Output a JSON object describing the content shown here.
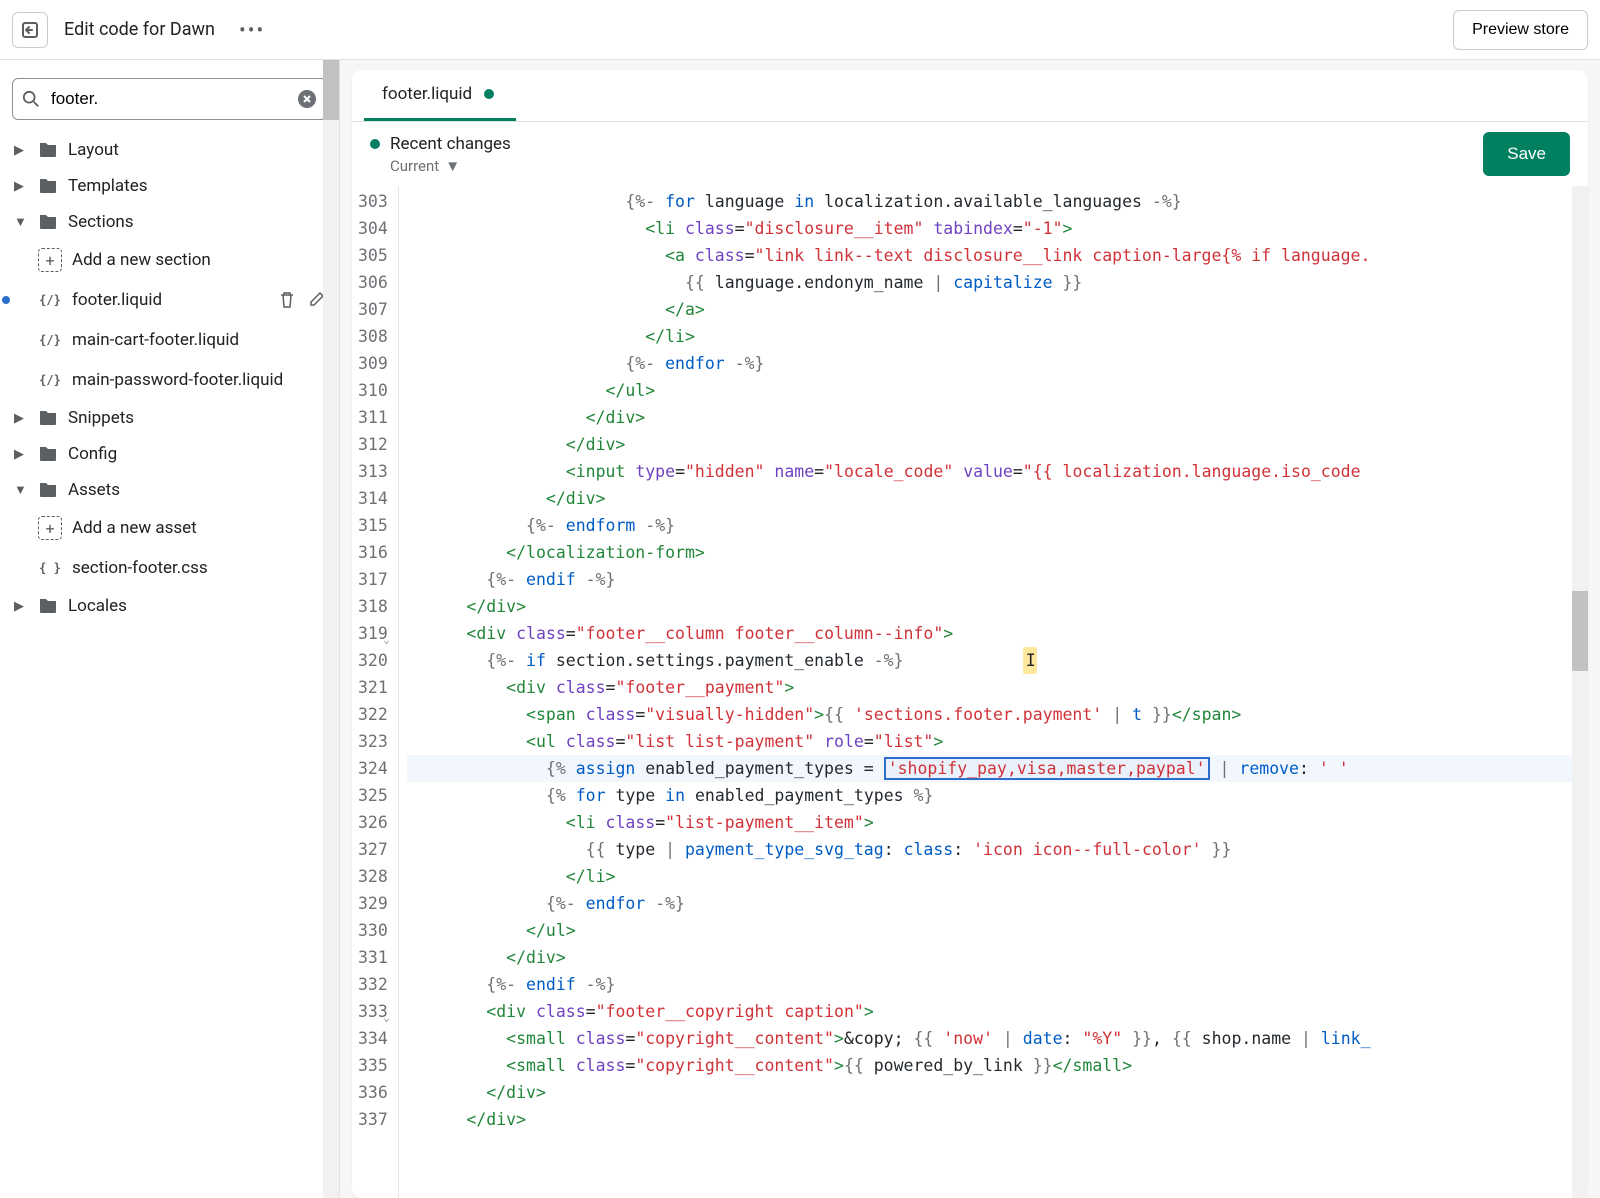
{
  "topbar": {
    "title": "Edit code for Dawn",
    "preview_label": "Preview store"
  },
  "sidebar": {
    "search_value": "footer.",
    "folders": {
      "layout": "Layout",
      "templates": "Templates",
      "sections": "Sections",
      "snippets": "Snippets",
      "config": "Config",
      "assets": "Assets",
      "locales": "Locales"
    },
    "add_section": "Add a new section",
    "add_asset": "Add a new asset",
    "files": {
      "footer": "footer.liquid",
      "main_cart": "main-cart-footer.liquid",
      "main_password": "main-password-footer.liquid",
      "section_footer_css": "section-footer.css"
    }
  },
  "editor": {
    "tab_name": "footer.liquid",
    "recent_changes": "Recent changes",
    "current": "Current",
    "save": "Save"
  },
  "code": {
    "lines": [
      {
        "n": 303,
        "html": "                      <span class='c-liq'>{%-</span> <span class='c-kw'>for</span> <span class='c-var'>language</span> <span class='c-kw'>in</span> <span class='c-var'>localization.available_languages</span> <span class='c-liq'>-%}</span>"
      },
      {
        "n": 304,
        "html": "                        <span class='c-tag'>&lt;li</span> <span class='c-attr'>class</span>=<span class='c-str'>\"disclosure__item\"</span> <span class='c-attr'>tabindex</span>=<span class='c-str'>\"-1\"</span><span class='c-tag'>&gt;</span>"
      },
      {
        "n": 305,
        "html": "                          <span class='c-tag'>&lt;a</span> <span class='c-attr'>class</span>=<span class='c-str'>\"link link--text disclosure__link caption-large{% if language.</span>"
      },
      {
        "n": 306,
        "html": "                            <span class='c-liq'>{{</span> <span class='c-var'>language.endonym_name</span> <span class='c-liq'>|</span> <span class='c-filter'>capitalize</span> <span class='c-liq'>}}</span>"
      },
      {
        "n": 307,
        "html": "                          <span class='c-tag'>&lt;/a&gt;</span>"
      },
      {
        "n": 308,
        "html": "                        <span class='c-tag'>&lt;/li&gt;</span>"
      },
      {
        "n": 309,
        "html": "                      <span class='c-liq'>{%-</span> <span class='c-kw'>endfor</span> <span class='c-liq'>-%}</span>"
      },
      {
        "n": 310,
        "html": "                    <span class='c-tag'>&lt;/ul&gt;</span>"
      },
      {
        "n": 311,
        "html": "                  <span class='c-tag'>&lt;/div&gt;</span>"
      },
      {
        "n": 312,
        "html": "                <span class='c-tag'>&lt;/div&gt;</span>"
      },
      {
        "n": 313,
        "html": "                <span class='c-tag'>&lt;input</span> <span class='c-attr'>type</span>=<span class='c-str'>\"hidden\"</span> <span class='c-attr'>name</span>=<span class='c-str'>\"locale_code\"</span> <span class='c-attr'>value</span>=<span class='c-str'>\"{{ localization.language.iso_code</span>"
      },
      {
        "n": 314,
        "html": "              <span class='c-tag'>&lt;/div&gt;</span>"
      },
      {
        "n": 315,
        "html": "            <span class='c-liq'>{%-</span> <span class='c-kw'>endform</span> <span class='c-liq'>-%}</span>"
      },
      {
        "n": 316,
        "html": "          <span class='c-tag'>&lt;/localization-form&gt;</span>"
      },
      {
        "n": 317,
        "html": "        <span class='c-liq'>{%-</span> <span class='c-kw'>endif</span> <span class='c-liq'>-%}</span>"
      },
      {
        "n": 318,
        "html": "      <span class='c-tag'>&lt;/div&gt;</span>"
      },
      {
        "n": 319,
        "fold": true,
        "html": "      <span class='c-tag'>&lt;div</span> <span class='c-attr'>class</span>=<span class='c-str'>\"footer__column footer__column--info\"</span><span class='c-tag'>&gt;</span>"
      },
      {
        "n": 320,
        "cursor": true,
        "html": "        <span class='c-liq'>{%-</span> <span class='c-kw'>if</span> <span class='c-var'>section.settings.payment_enable</span> <span class='c-liq'>-%}</span>            <span class='cursor-mark'>I</span>"
      },
      {
        "n": 321,
        "html": "          <span class='c-tag'>&lt;div</span> <span class='c-attr'>class</span>=<span class='c-str'>\"footer__payment\"</span><span class='c-tag'>&gt;</span>"
      },
      {
        "n": 322,
        "html": "            <span class='c-tag'>&lt;span</span> <span class='c-attr'>class</span>=<span class='c-str'>\"visually-hidden\"</span><span class='c-tag'>&gt;</span><span class='c-liq'>{{</span> <span class='c-str'>'sections.footer.payment'</span> <span class='c-liq'>|</span> <span class='c-filter'>t</span> <span class='c-liq'>}}</span><span class='c-tag'>&lt;/span&gt;</span>"
      },
      {
        "n": 323,
        "html": "            <span class='c-tag'>&lt;ul</span> <span class='c-attr'>class</span>=<span class='c-str'>\"list list-payment\"</span> <span class='c-attr'>role</span>=<span class='c-str'>\"list\"</span><span class='c-tag'>&gt;</span>"
      },
      {
        "n": 324,
        "hl": true,
        "html": "              <span class='c-liq'>{%</span> <span class='c-kw'>assign</span> <span class='c-var'>enabled_payment_types</span> = <span class='sel-box'><span class='c-str'>'shopify_pay,visa,master,paypal'</span></span> <span class='c-liq'>|</span> <span class='c-filter'>remove</span>: <span class='c-str'>' '</span>"
      },
      {
        "n": 325,
        "html": "              <span class='c-liq'>{%</span> <span class='c-kw'>for</span> <span class='c-var'>type</span> <span class='c-kw'>in</span> <span class='c-var'>enabled_payment_types</span> <span class='c-liq'>%}</span>"
      },
      {
        "n": 326,
        "html": "                <span class='c-tag'>&lt;li</span> <span class='c-attr'>class</span>=<span class='c-str'>\"list-payment__item\"</span><span class='c-tag'>&gt;</span>"
      },
      {
        "n": 327,
        "html": "                  <span class='c-liq'>{{</span> <span class='c-var'>type</span> <span class='c-liq'>|</span> <span class='c-filter'>payment_type_svg_tag</span>: <span class='c-filter'>class</span>: <span class='c-str'>'icon icon--full-color'</span> <span class='c-liq'>}}</span>"
      },
      {
        "n": 328,
        "html": "                <span class='c-tag'>&lt;/li&gt;</span>"
      },
      {
        "n": 329,
        "html": "              <span class='c-liq'>{%-</span> <span class='c-kw'>endfor</span> <span class='c-liq'>-%}</span>"
      },
      {
        "n": 330,
        "html": "            <span class='c-tag'>&lt;/ul&gt;</span>"
      },
      {
        "n": 331,
        "html": "          <span class='c-tag'>&lt;/div&gt;</span>"
      },
      {
        "n": 332,
        "html": "        <span class='c-liq'>{%-</span> <span class='c-kw'>endif</span> <span class='c-liq'>-%}</span>"
      },
      {
        "n": 333,
        "fold": true,
        "html": "        <span class='c-tag'>&lt;div</span> <span class='c-attr'>class</span>=<span class='c-str'>\"footer__copyright caption\"</span><span class='c-tag'>&gt;</span>"
      },
      {
        "n": 334,
        "html": "          <span class='c-tag'>&lt;small</span> <span class='c-attr'>class</span>=<span class='c-str'>\"copyright__content\"</span><span class='c-tag'>&gt;</span>&amp;copy; <span class='c-liq'>{{</span> <span class='c-str'>'now'</span> <span class='c-liq'>|</span> <span class='c-filter'>date</span>: <span class='c-str'>\"%Y\"</span> <span class='c-liq'>}}</span>, <span class='c-liq'>{{</span> <span class='c-var'>shop.name</span> <span class='c-liq'>|</span> <span class='c-filter'>link_</span>"
      },
      {
        "n": 335,
        "html": "          <span class='c-tag'>&lt;small</span> <span class='c-attr'>class</span>=<span class='c-str'>\"copyright__content\"</span><span class='c-tag'>&gt;</span><span class='c-liq'>{{</span> <span class='c-var'>powered_by_link</span> <span class='c-liq'>}}</span><span class='c-tag'>&lt;/small&gt;</span>"
      },
      {
        "n": 336,
        "html": "        <span class='c-tag'>&lt;/div&gt;</span>"
      },
      {
        "n": 337,
        "html": "      <span class='c-tag'>&lt;/div&gt;</span>"
      }
    ]
  }
}
